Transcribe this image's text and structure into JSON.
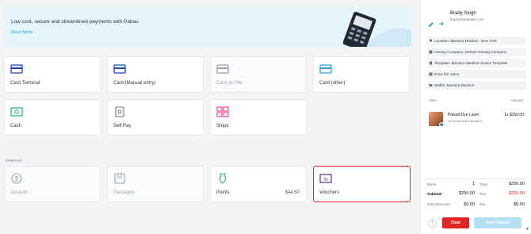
{
  "banner": {
    "title": "Low cost, secure and streamlined payments with Pabau",
    "link": "Read More"
  },
  "payment_methods": [
    {
      "label": "Card Terminal",
      "icon": "card-icon",
      "disabled": false
    },
    {
      "label": "Card (Manual entry)",
      "icon": "card-icon",
      "disabled": false
    },
    {
      "label": "Card on File",
      "icon": "card-icon",
      "disabled": true
    },
    {
      "label": "Card (other)",
      "icon": "card-icon",
      "disabled": false
    },
    {
      "label": "Cash",
      "icon": "cash-icon",
      "disabled": false
    },
    {
      "label": "Self Pay",
      "icon": "self-pay-icon",
      "disabled": false
    },
    {
      "label": "Stripe",
      "icon": "stripe-icon",
      "disabled": false
    }
  ],
  "prepaid": {
    "section_label": "PREPAID",
    "items": [
      {
        "label": "Account",
        "icon": "dollar-icon",
        "disabled": true,
        "amount": ""
      },
      {
        "label": "Packages",
        "icon": "package-icon",
        "disabled": true,
        "amount": ""
      },
      {
        "label": "Points",
        "icon": "points-icon",
        "disabled": false,
        "amount": "$44.50"
      },
      {
        "label": "Vouchers",
        "icon": "voucher-icon",
        "disabled": false,
        "amount": "",
        "selected": true
      }
    ]
  },
  "customer": {
    "name": "Brady Singh",
    "email": "brady@example.com"
  },
  "info_rows": [
    {
      "icon": "location-icon",
      "text": "Location: Maniera Medical - New York"
    },
    {
      "icon": "company-icon",
      "text": "Issuing Company: Default Issuing Company"
    },
    {
      "icon": "template-icon",
      "text": "Template: Maniera Medical Invoice Template"
    },
    {
      "icon": "price-list-icon",
      "text": "Price list: None"
    },
    {
      "icon": "wallet-icon",
      "text": "Wallet: Maniera Medical"
    }
  ],
  "items_table": {
    "col_item": "Item",
    "col_amount": "Amount",
    "rows": [
      {
        "name": "Pulsed Dye Laser",
        "sub": "10:00 AM with Daphne D...",
        "price": "1x $250.00"
      }
    ]
  },
  "totals": {
    "items_label": "Items",
    "items_value": "1",
    "subtotal_label": "Subtotal",
    "subtotal_value": "$250.00",
    "total_discount_label": "Total Discount",
    "total_discount_value": "$0.00",
    "total_label": "Total",
    "total_value": "$250.00",
    "due_label": "Due",
    "due_value": "$250.00",
    "tax_label": "Tax",
    "tax_value": "$0.00"
  },
  "actions": {
    "more": "⋮",
    "clear": "Clear",
    "save": "Save Unpaid"
  },
  "colors": {
    "accent": "#2aa3d6",
    "danger": "#e02424",
    "disabled_button": "#b3e0f2"
  }
}
